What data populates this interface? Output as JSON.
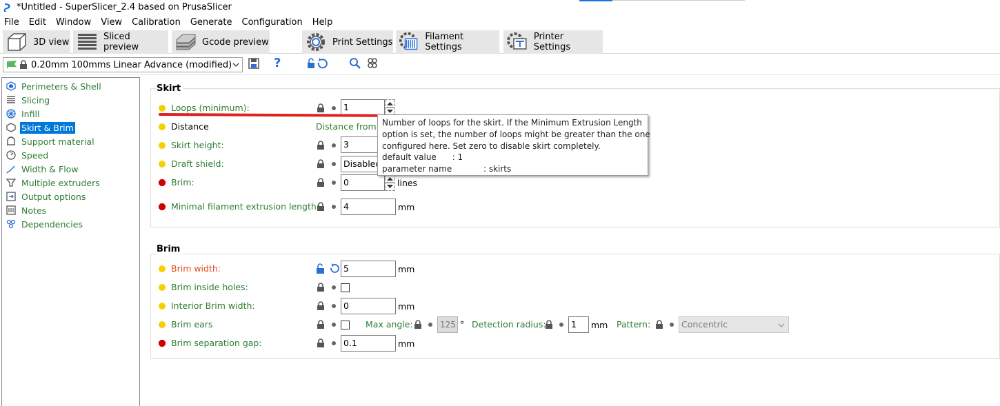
{
  "window": {
    "title": "*Untitled - SuperSlicer_2.4  based on PrusaSlicer"
  },
  "menu": [
    "File",
    "Edit",
    "Window",
    "View",
    "Calibration",
    "Generate",
    "Configuration",
    "Help"
  ],
  "tabs": [
    {
      "label": "3D view",
      "icon": "cube-icon",
      "active": false
    },
    {
      "label": "Sliced preview",
      "icon": "layers-icon",
      "active": false
    },
    {
      "label": "Gcode preview",
      "icon": "gcode-layers-icon",
      "active": false
    },
    {
      "label": "Print Settings",
      "icon": "cog-icon",
      "active": true
    },
    {
      "label": "Filament Settings",
      "icon": "spool-icon",
      "active": false
    },
    {
      "label": "Printer Settings",
      "icon": "printer-cog-icon",
      "active": false
    }
  ],
  "preset": {
    "value": "0.20mm 100mms Linear Advance (modified)",
    "help_glyph": "?"
  },
  "sidebar": {
    "selected": "Skirt & Brim",
    "items": [
      {
        "label": "Perimeters & Shell",
        "icon": "perimeters-icon"
      },
      {
        "label": "Slicing",
        "icon": "slicing-icon"
      },
      {
        "label": "Infill",
        "icon": "infill-icon"
      },
      {
        "label": "Skirt & Brim",
        "icon": "skirt-icon"
      },
      {
        "label": "Support material",
        "icon": "support-icon"
      },
      {
        "label": "Speed",
        "icon": "speed-icon"
      },
      {
        "label": "Width & Flow",
        "icon": "width-flow-icon"
      },
      {
        "label": "Multiple extruders",
        "icon": "extruders-icon"
      },
      {
        "label": "Output options",
        "icon": "output-icon"
      },
      {
        "label": "Notes",
        "icon": "notes-icon"
      },
      {
        "label": "Dependencies",
        "icon": "dependencies-icon"
      }
    ]
  },
  "skirt": {
    "title": "Skirt",
    "loops": {
      "label": "Loops (minimum):",
      "value": "1"
    },
    "distance": {
      "label": "Distance",
      "value_label": "Distance from o"
    },
    "height": {
      "label": "Skirt height:",
      "value": "3"
    },
    "draft_shield": {
      "label": "Draft shield:",
      "value": "Disabled"
    },
    "brim": {
      "label": "Brim:",
      "value": "0",
      "unit": "lines"
    },
    "min_extrusion": {
      "label": "Minimal filament extrusion length:",
      "value": "4",
      "unit": "mm"
    }
  },
  "brim": {
    "title": "Brim",
    "width": {
      "label": "Brim width:",
      "value": "5",
      "unit": "mm"
    },
    "inside_holes": {
      "label": "Brim inside holes:"
    },
    "interior_width": {
      "label": "Interior Brim width:",
      "value": "0",
      "unit": "mm"
    },
    "ears": {
      "label": "Brim ears",
      "max_angle_label": "Max angle:",
      "max_angle_value": "125",
      "degree": "°",
      "detection_label": "Detection radius:",
      "detection_value": "1",
      "detection_unit": "mm",
      "pattern_label": "Pattern:",
      "pattern_value": "Concentric"
    },
    "separation_gap": {
      "label": "Brim separation gap:",
      "value": "0.1",
      "unit": "mm"
    }
  },
  "tooltip": {
    "lines": [
      "Number of loops for the skirt. If the Minimum Extrusion Length",
      "option is set, the number of loops might be greater than the one",
      "configured here. Set zero to disable skirt completely.",
      "default value      : 1",
      "parameter name            : skirts"
    ]
  },
  "colors": {
    "label_green": "#2e7d32",
    "modified_orange": "#e24a1a",
    "selection_blue": "#0078d7",
    "dot_yellow": "#f5d100",
    "dot_red": "#d10000",
    "tab_bg": "#e6e6e6"
  }
}
